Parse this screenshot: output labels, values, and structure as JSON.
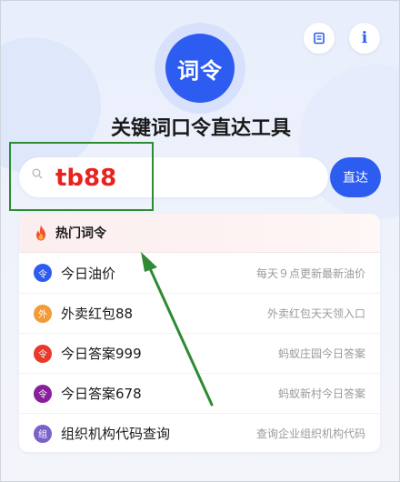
{
  "header": {
    "logo_text": "词令",
    "title": "关键词口令直达工具",
    "save_icon": "bookmark-icon",
    "info_label": "i"
  },
  "search": {
    "value": "tb88",
    "go_label": "直达"
  },
  "hot": {
    "title": "热门词令",
    "items": [
      {
        "badge": "令",
        "name": "今日油价",
        "desc": "每天９点更新最新油价",
        "color": "#2d5cf0"
      },
      {
        "badge": "外",
        "name": "外卖红包88",
        "desc": "外卖红包天天领入口",
        "color": "#f29b38"
      },
      {
        "badge": "令",
        "name": "今日答案999",
        "desc": "蚂蚁庄园今日答案",
        "color": "#e8392b"
      },
      {
        "badge": "令",
        "name": "今日答案678",
        "desc": "蚂蚁新村今日答案",
        "color": "#8a1f9c"
      },
      {
        "badge": "组",
        "name": "组织机构代码查询",
        "desc": "查询企业组织机构代码",
        "color": "#7b62c9"
      }
    ]
  },
  "colors": {
    "accent": "#2d5cf0",
    "annotation": "#2f8a34",
    "query_text": "#e8231f"
  }
}
